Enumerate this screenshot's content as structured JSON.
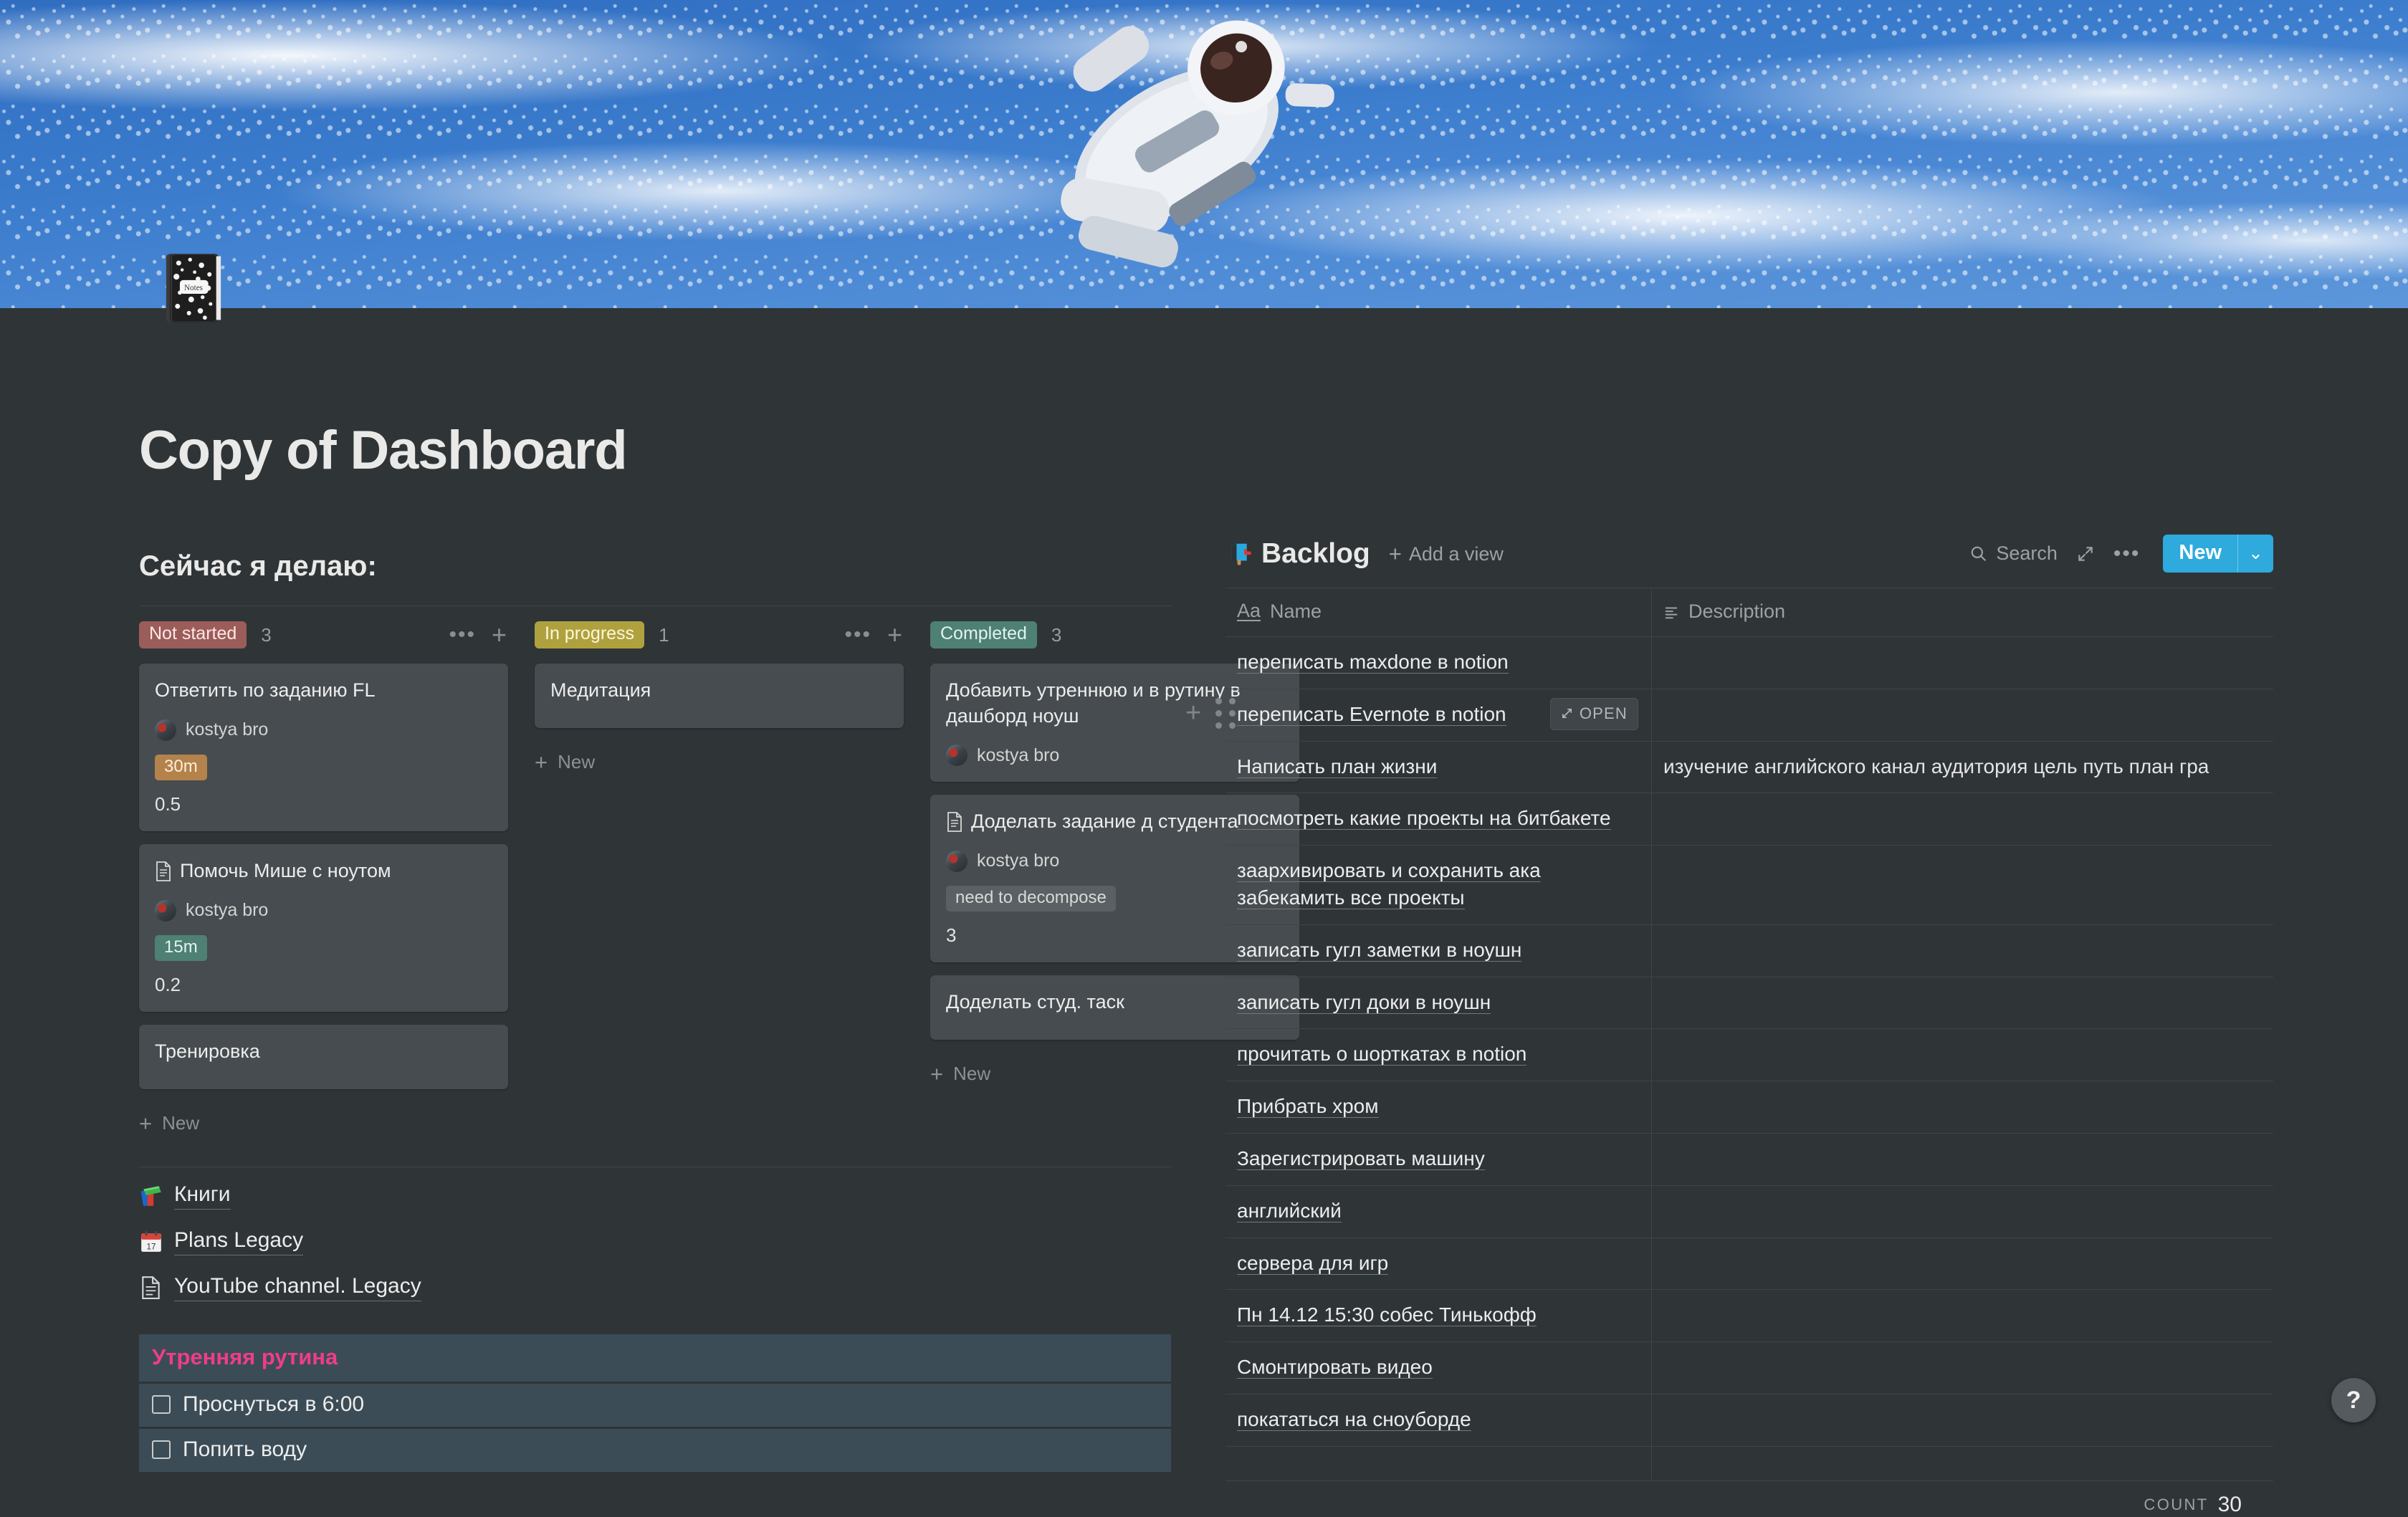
{
  "page": {
    "icon": "notebook-emoji",
    "title": "Copy of Dashboard",
    "cover": "astronaut-spacewalk-photo"
  },
  "board": {
    "heading": "Сейчас я делаю:",
    "columns": [
      {
        "status": "Not started",
        "status_color": "#9b5d5a",
        "count": "3",
        "new_label": "New",
        "cards": [
          {
            "title": "Ответить по заданию FL",
            "has_doc_icon": false,
            "person": "kostya bro",
            "tag": "30m",
            "tag_color": "#b4824b",
            "number": "0.5"
          },
          {
            "title": "Помочь Мише с ноутом",
            "has_doc_icon": true,
            "person": "kostya bro",
            "tag": "15m",
            "tag_color": "#4e8073",
            "number": "0.2"
          },
          {
            "title": "Тренировка",
            "has_doc_icon": false,
            "person": "",
            "tag": "",
            "number": ""
          }
        ]
      },
      {
        "status": "In progress",
        "status_color": "#b0a13f",
        "count": "1",
        "new_label": "New",
        "cards": [
          {
            "title": "Медитация",
            "has_doc_icon": false,
            "person": "",
            "tag": "",
            "number": ""
          }
        ]
      },
      {
        "status": "Completed",
        "status_color": "#4e8073",
        "count": "3",
        "new_label": "New",
        "cards": [
          {
            "title": "Добавить утреннюю и в рутину в дашборд ноуш",
            "has_doc_icon": false,
            "person": "kostya bro",
            "tag": "",
            "number": ""
          },
          {
            "title": "Доделать задание д студента",
            "has_doc_icon": true,
            "person": "kostya bro",
            "tag": "need to decompose",
            "tag_color": "#5a6063",
            "number": "3"
          },
          {
            "title": "Доделать студ. таск",
            "has_doc_icon": false,
            "person": "",
            "tag": "",
            "number": ""
          }
        ]
      }
    ]
  },
  "page_links": [
    {
      "icon": "books-emoji",
      "label": "Книги"
    },
    {
      "icon": "calendar-emoji",
      "label": "Plans Legacy"
    },
    {
      "icon": "document-icon",
      "label": "YouTube channel. Legacy"
    }
  ],
  "routine": {
    "heading": "Утренняя рутина",
    "heading_color": "#ef3c8c",
    "background_color": "#3c4c56",
    "items": [
      {
        "label": "Проснуться в 6:00",
        "checked": false
      },
      {
        "label": "Попить воду",
        "checked": false
      }
    ]
  },
  "backlog": {
    "icon": "mailbox-emoji",
    "title": "Backlog",
    "add_view_label": "Add a view",
    "search_label": "Search",
    "expand_icon": "expand-icon",
    "more_icon": "more-options-icon",
    "new_button": "New",
    "new_button_color": "#2eaadc",
    "open_button_label": "OPEN",
    "columns": [
      {
        "icon": "title-type-icon",
        "label": "Name"
      },
      {
        "icon": "text-type-icon",
        "label": "Description"
      }
    ],
    "rows": [
      {
        "name": "переписать maxdone в notion",
        "description": "",
        "hovered": false
      },
      {
        "name": "переписать Evernote в notion",
        "description": "",
        "hovered": true
      },
      {
        "name": "Написать план жизни",
        "description": "изучение английского канал аудитория цель путь план гра",
        "hovered": false
      },
      {
        "name": "посмотреть какие проекты на битбакете",
        "description": "",
        "hovered": false
      },
      {
        "name": "заархивировать и сохранить ака забекамить все проекты",
        "description": "",
        "hovered": false
      },
      {
        "name": "записать гугл заметки в ноушн",
        "description": "",
        "hovered": false
      },
      {
        "name": "записать гугл доки в ноушн",
        "description": "",
        "hovered": false
      },
      {
        "name": "прочитать о шорткатах в notion",
        "description": "",
        "hovered": false
      },
      {
        "name": "Прибрать хром",
        "description": "",
        "hovered": false
      },
      {
        "name": "Зарегистрировать машину",
        "description": "",
        "hovered": false
      },
      {
        "name": "английский",
        "description": "",
        "hovered": false
      },
      {
        "name": "сервера для игр",
        "description": "",
        "hovered": false
      },
      {
        "name": "Пн 14.12 15:30 собес Тинькофф",
        "description": "",
        "hovered": false
      },
      {
        "name": "Смонтировать видео",
        "description": "",
        "hovered": false
      },
      {
        "name": "покататься на сноуборде",
        "description": "",
        "hovered": false
      }
    ],
    "count_label": "COUNT",
    "count_value": "30"
  },
  "help": {
    "label": "?"
  }
}
